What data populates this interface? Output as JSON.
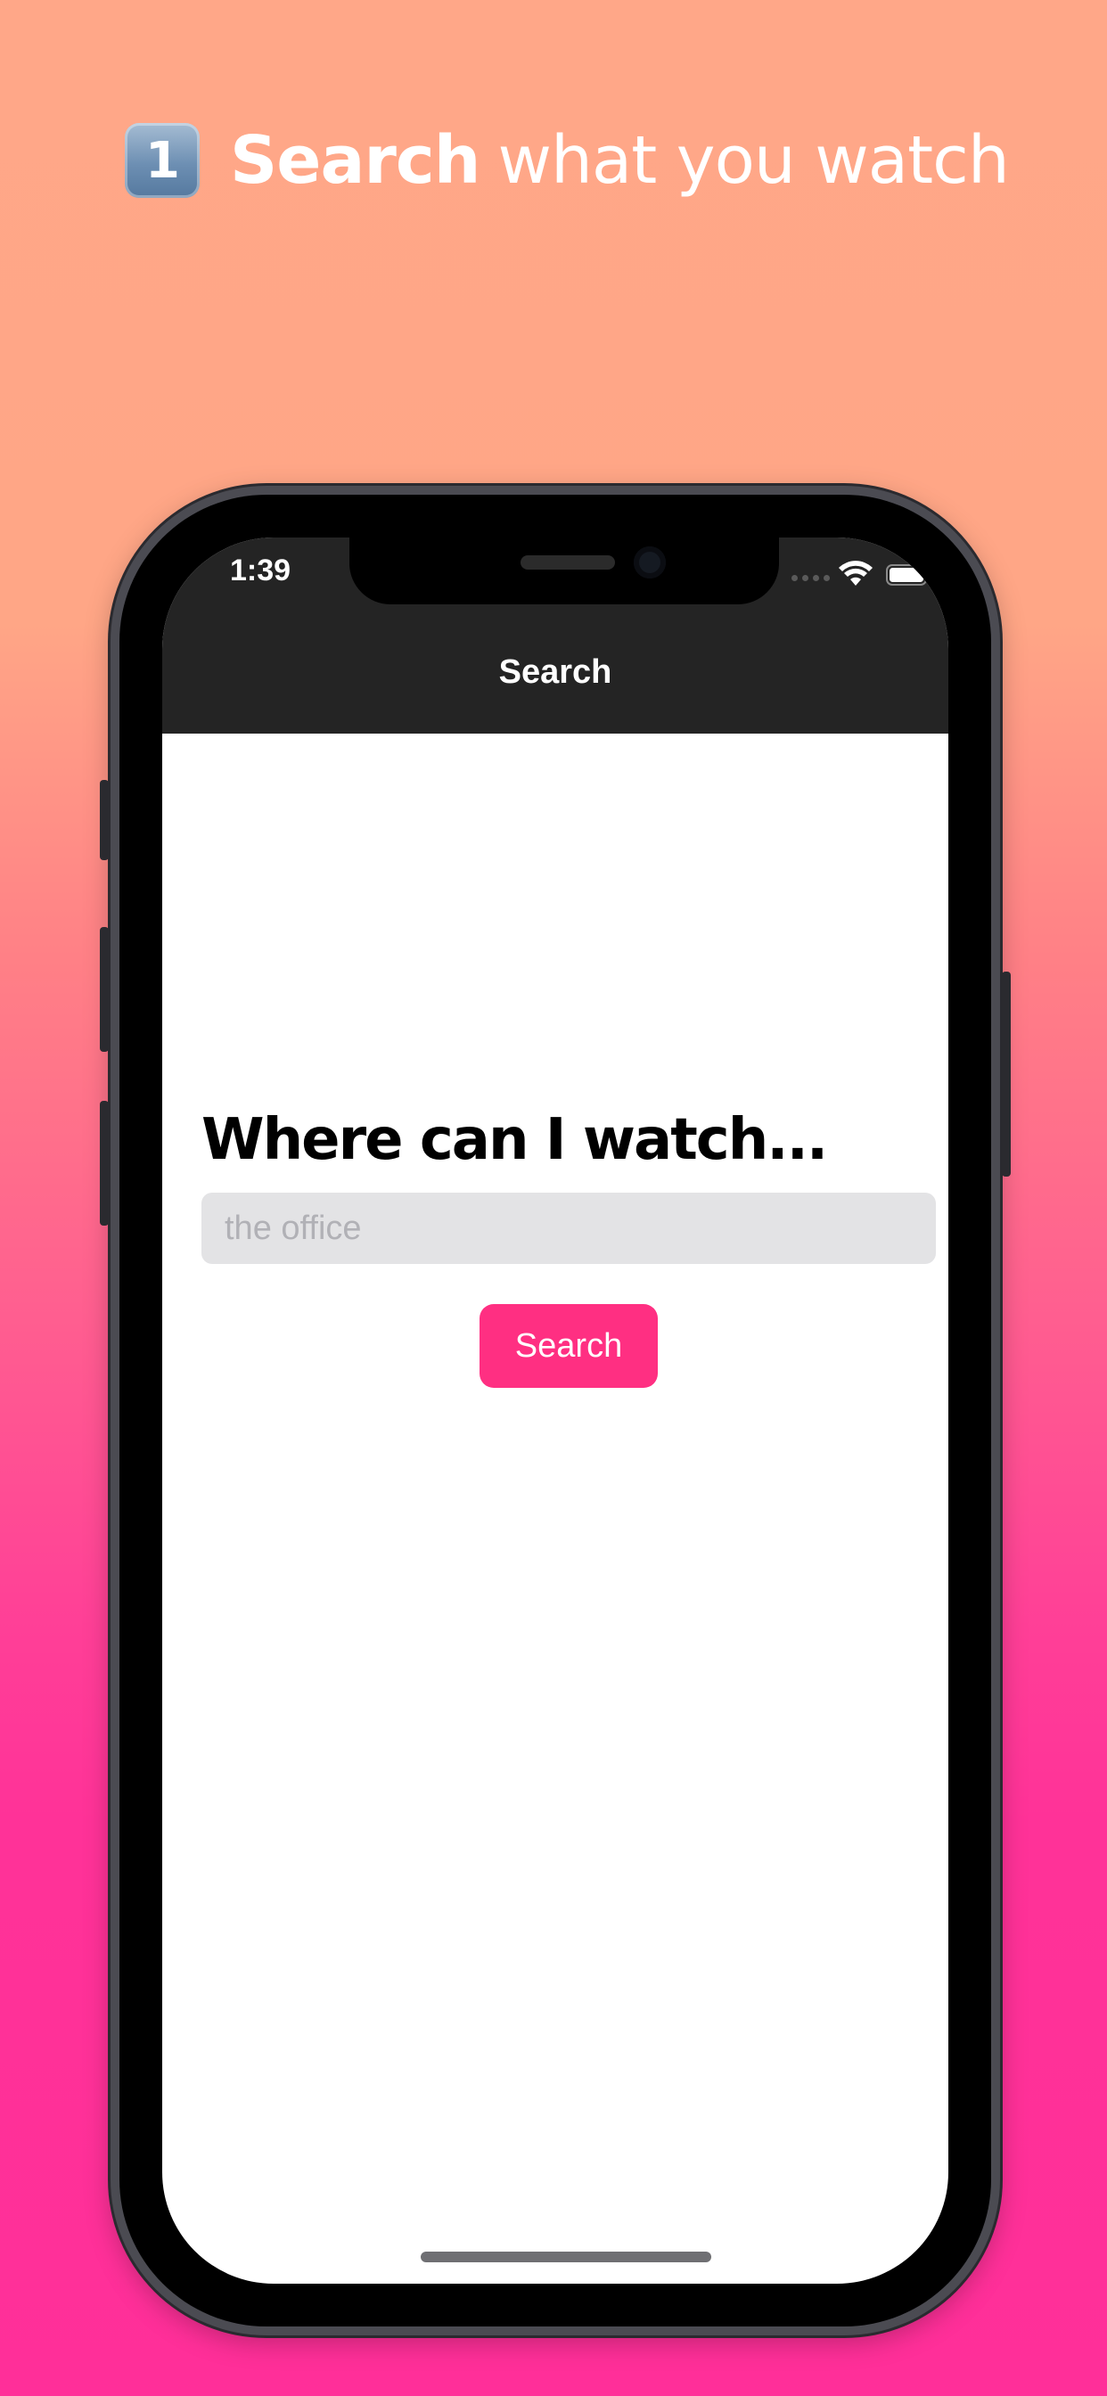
{
  "headline": {
    "step_number": "1",
    "strong_text": "Search",
    "light_text": "what you watch"
  },
  "status_bar": {
    "time": "1:39",
    "signal_icon": "cellular-signal-icon",
    "wifi_icon": "wifi-icon",
    "battery_icon": "battery-icon"
  },
  "nav": {
    "title": "Search"
  },
  "main": {
    "question": "Where can I watch...",
    "search_placeholder": "the office",
    "search_value": "",
    "search_button_label": "Search"
  },
  "colors": {
    "accent": "#ff2f82",
    "nav_background": "#242424",
    "field_background": "#e3e3e5",
    "gradient_top": "#ffa788",
    "gradient_bottom": "#ff2f99"
  }
}
